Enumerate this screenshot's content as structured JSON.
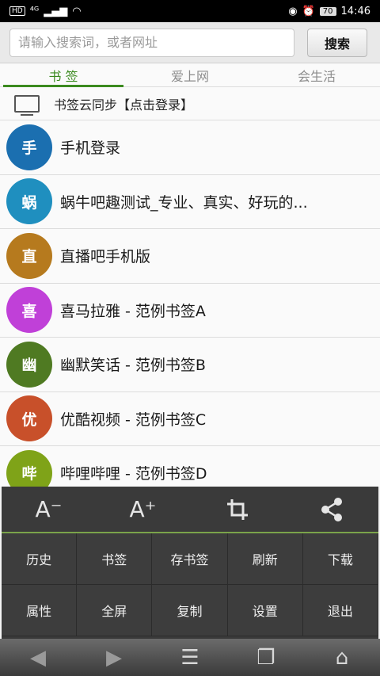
{
  "status_bar": {
    "network": "HD",
    "signal": "⁴ᴳ",
    "battery": "70",
    "time": "14:46"
  },
  "search": {
    "placeholder": "请输入搜索词，或者网址",
    "button_label": "搜索"
  },
  "tabs": [
    {
      "label": "书 签",
      "active": true
    },
    {
      "label": "爱上网",
      "active": false
    },
    {
      "label": "会生活",
      "active": false
    }
  ],
  "sync": {
    "label": "书签云同步【点击登录】"
  },
  "bookmarks": [
    {
      "initial": "手",
      "title": "手机登录",
      "color": "#1b6fb0"
    },
    {
      "initial": "蜗",
      "title": "蜗牛吧趣测试_专业、真实、好玩的...",
      "color": "#1f8fbf"
    },
    {
      "initial": "直",
      "title": "直播吧手机版",
      "color": "#b67a1e"
    },
    {
      "initial": "喜",
      "title": "喜马拉雅 - 范例书签A",
      "color": "#c040d8"
    },
    {
      "initial": "幽",
      "title": "幽默笑话 - 范例书签B",
      "color": "#4f7a22"
    },
    {
      "initial": "优",
      "title": "优酷视频 - 范例书签C",
      "color": "#c8502a"
    },
    {
      "initial": "哔",
      "title": "哔哩哔哩 - 范例书签D",
      "color": "#7fa318"
    }
  ],
  "menu": {
    "icons": [
      "font-decrease-icon",
      "font-increase-icon",
      "crop-icon",
      "share-icon"
    ],
    "font_decrease": "A⁻",
    "font_increase": "A⁺",
    "crop": "⌗",
    "share": "⋖",
    "items": [
      "历史",
      "书签",
      "存书签",
      "刷新",
      "下载",
      "属性",
      "全屏",
      "复制",
      "设置",
      "退出"
    ]
  },
  "bottom_nav": {
    "back": "◀",
    "forward": "▶",
    "menu": "☰",
    "windows": "❐",
    "home": "⌂"
  }
}
